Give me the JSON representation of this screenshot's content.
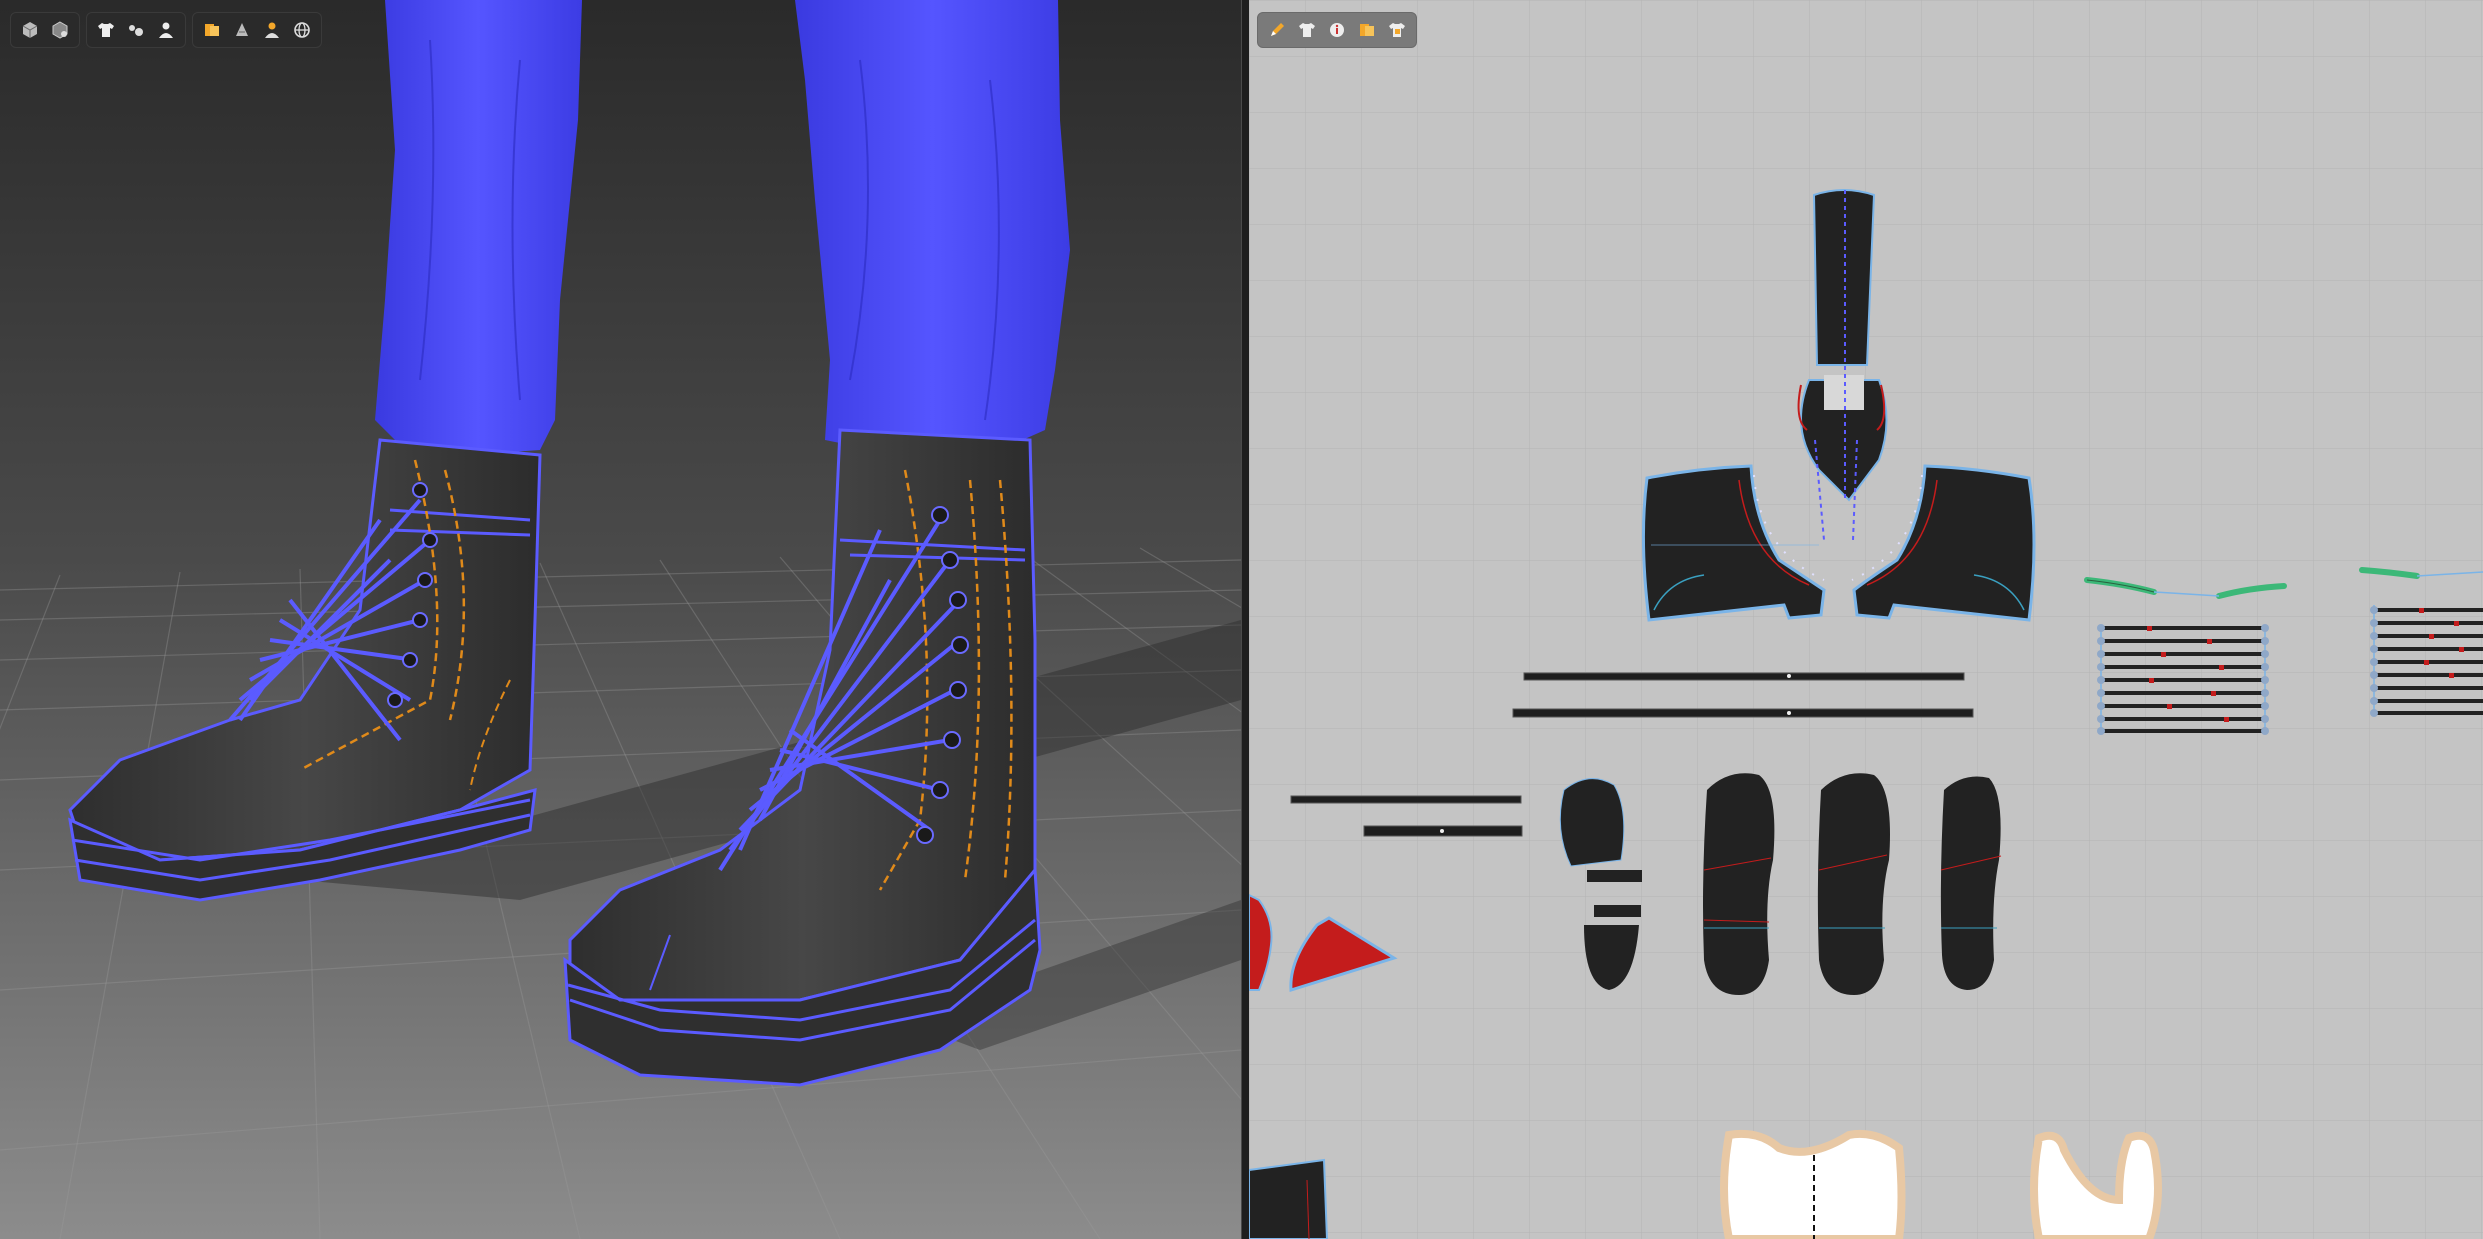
{
  "app": {
    "views": [
      "3d-garment-window",
      "2d-pattern-window"
    ]
  },
  "toolbar3d": {
    "groups": [
      [
        "cube-view-icon",
        "cube-wire-icon"
      ],
      [
        "tshirt-icon",
        "fabric-icon",
        "avatar-icon"
      ],
      [
        "texture-icon",
        "surface-icon",
        "avatar-texture-icon",
        "globe-icon"
      ]
    ]
  },
  "toolbar2d": {
    "groups": [
      [
        "pencil-icon",
        "tshirt-icon",
        "info-icon",
        "texture-icon",
        "tshirt-texture-icon"
      ]
    ]
  },
  "colors": {
    "avatar_pants": "#4a4af0",
    "boot_body": "#3b3b3b",
    "outline": "#5b5bff",
    "topstitch": "#e08a1a",
    "pattern_bg": "#c4c4c4",
    "pattern_piece": "#222222",
    "pattern_outline": "#7ab4e8",
    "red_piece": "#c41c1c",
    "green_strap": "#3cb878",
    "fabric_white": "#ffffff",
    "fabric_trim": "#e8c8a4",
    "viewport_bg_top": "#2e2e2e",
    "viewport_bg_bottom": "#8a8a8a"
  }
}
